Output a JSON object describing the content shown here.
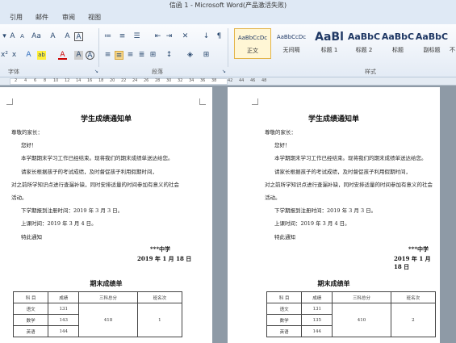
{
  "window": {
    "title": "信函 1 - Microsoft Word(产品激活失败)"
  },
  "menu": {
    "tabs": [
      "引用",
      "邮件",
      "审阅",
      "视图"
    ]
  },
  "ribbon": {
    "groups": {
      "font": "字体",
      "paragraph": "段落",
      "styles": "样式"
    },
    "font_items": {
      "grow": "A",
      "shrink": "A",
      "case": "Aa",
      "clear": "A",
      "phonetic": "A",
      "border": "A",
      "bold": "B",
      "italic": "I",
      "underline": "U",
      "sub": "x",
      "sup": "x²",
      "color": "A",
      "char_shading": "A",
      "highlight": "ab",
      "char_border": "A"
    },
    "styles": [
      {
        "preview": "AaBbCcDc",
        "name": "正文",
        "selected": true
      },
      {
        "preview": "AaBbCcDc",
        "name": "无间隔",
        "selected": false
      },
      {
        "preview": "AaBl",
        "name": "标题 1",
        "selected": false
      },
      {
        "preview": "AaBbC",
        "name": "标题 2",
        "selected": false
      },
      {
        "preview": "AaBbC",
        "name": "标题",
        "selected": false
      },
      {
        "preview": "AaBbC",
        "name": "副标题",
        "selected": false
      },
      {
        "preview": "",
        "name": "不",
        "selected": false
      }
    ]
  },
  "ruler": {
    "labels": [
      "2",
      "4",
      "6",
      "8",
      "10",
      "12",
      "14",
      "16",
      "18",
      "20",
      "22",
      "24",
      "26",
      "28",
      "30",
      "32",
      "34",
      "36",
      "38",
      "42",
      "44",
      "46",
      "48"
    ]
  },
  "page_left": {
    "title": "学生成绩通知单",
    "salutation": "尊敬的家长：",
    "greeting": "您好！",
    "line1": "本学期期末学习工作已经结束。现将我们的期末成绩单送达给您。",
    "line2a": "请家长根据孩子的考试成绩，及时督促孩子利用假期时间，",
    "line2b": "对之前所学知识点进行查漏补缺，同时安排适量的时间参加有意义的社会",
    "line2c": "活动。",
    "line3": "下学期报到注册时间：2019 年 3 月 3 日。",
    "line4": "上课时间：2019 年 3 月 4 日。",
    "line5": "特此通知",
    "school": "***中学",
    "date": "2019 年 1 月 18 日",
    "table_title": "期末成绩单",
    "table": {
      "headers": [
        "科 目",
        "成绩",
        "三科总分",
        "班名次"
      ],
      "rows": [
        {
          "subject": "语文",
          "score": "131"
        },
        {
          "subject": "数学",
          "score": "143"
        },
        {
          "subject": "英语",
          "score": "144"
        }
      ],
      "total": "418",
      "rank": "1"
    }
  },
  "page_right": {
    "title": "学生成绩通知单",
    "salutation": "尊敬的家长：",
    "greeting": "您好！",
    "line1": "本学期期末学习工作已经结束。现将我们的期末成绩单送达给您。",
    "line2a": "请家长根据孩子的考试成绩，及时督促孩子利用假期时间，",
    "line2b": "对之前所学知识点进行查漏补缺，同时安排适量的时间参加有意义的社会",
    "line2c": "活动。",
    "line3": "下学期报到注册时间：2019 年 3 月 3 日。",
    "line4": "上课时间：2019 年 3 月 4 日。",
    "line5": "特此通知",
    "school": "***中学",
    "date": "2019 年 1 月 18 日",
    "table_title": "期末成绩单",
    "table": {
      "headers": [
        "科 目",
        "成绩",
        "三科总分",
        "班名次"
      ],
      "rows": [
        {
          "subject": "语文",
          "score": "131"
        },
        {
          "subject": "数学",
          "score": "135"
        },
        {
          "subject": "英语",
          "score": "144"
        }
      ],
      "total": "410",
      "rank": "2"
    }
  }
}
